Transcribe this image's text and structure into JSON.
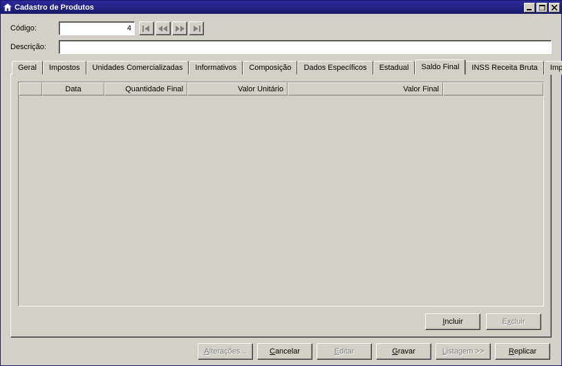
{
  "window": {
    "title": "Cadastro de Produtos"
  },
  "form": {
    "codigo_label": "Código:",
    "codigo_value": "4",
    "descricao_label": "Descrição:",
    "descricao_value": ""
  },
  "tabs": [
    {
      "label": "Geral"
    },
    {
      "label": "Impostos"
    },
    {
      "label": "Unidades Comercializadas"
    },
    {
      "label": "Informativos"
    },
    {
      "label": "Composição"
    },
    {
      "label": "Dados Específicos"
    },
    {
      "label": "Estadual"
    },
    {
      "label": "Saldo Final",
      "active": true
    },
    {
      "label": "INSS Receita Bruta"
    },
    {
      "label": "Importações"
    }
  ],
  "grid": {
    "columns": [
      "",
      "Data",
      "Quantidade Final",
      "Valor Unitário",
      "Valor Final",
      ""
    ],
    "rows": []
  },
  "panel_buttons": {
    "incluir": "Incluir",
    "excluir": "Excluir"
  },
  "footer_buttons": {
    "alteracoes": "Alterações...",
    "cancelar": "Cancelar",
    "editar": "Editar",
    "gravar": "Gravar",
    "listagem": "Listagem >>",
    "replicar": "Replicar"
  }
}
